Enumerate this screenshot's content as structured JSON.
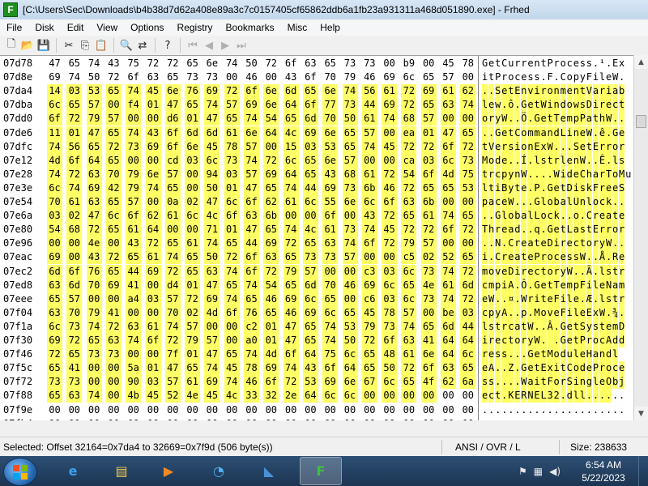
{
  "window": {
    "title": "[C:\\Users\\Sec\\Downloads\\b4b38d7d62a408e89a3c7c0157405cf65862ddb6a1fb23a931311a468d051890.exe] - Frhed",
    "icon": "frhed-icon",
    "icon_letter": "F"
  },
  "menu": [
    "File",
    "Disk",
    "Edit",
    "View",
    "Options",
    "Registry",
    "Bookmarks",
    "Misc",
    "Help"
  ],
  "toolbar": {
    "buttons": [
      {
        "name": "new-icon",
        "glyph": "🗋"
      },
      {
        "name": "open-icon",
        "glyph": "📂"
      },
      {
        "name": "save-icon",
        "glyph": "💾"
      },
      {
        "name": "cut-icon",
        "glyph": "✂"
      },
      {
        "name": "copy-icon",
        "glyph": "⎘"
      },
      {
        "name": "paste-icon",
        "glyph": "📋"
      },
      {
        "name": "find-icon",
        "glyph": "🔍"
      },
      {
        "name": "replace-icon",
        "glyph": "⇄"
      },
      {
        "name": "help-icon",
        "glyph": "?"
      },
      {
        "name": "first-icon",
        "glyph": "⏮"
      },
      {
        "name": "prev-icon",
        "glyph": "◀"
      },
      {
        "name": "next-icon",
        "glyph": "▶"
      },
      {
        "name": "last-icon",
        "glyph": "⏭"
      }
    ]
  },
  "hex": {
    "selection_color": "#ffff66",
    "rows": [
      {
        "offset": "07d78",
        "bytes": [
          "47",
          "65",
          "74",
          "43",
          "75",
          "72",
          "72",
          "65",
          "6e",
          "74",
          "50",
          "72",
          "6f",
          "63",
          "65",
          "73",
          "73",
          "00",
          "b9",
          "00",
          "45",
          "78"
        ],
        "sel_from": -1,
        "sel_to": -1,
        "ascii": "GetCurrentProcess.¹.Ex"
      },
      {
        "offset": "07d8e",
        "bytes": [
          "69",
          "74",
          "50",
          "72",
          "6f",
          "63",
          "65",
          "73",
          "73",
          "00",
          "46",
          "00",
          "43",
          "6f",
          "70",
          "79",
          "46",
          "69",
          "6c",
          "65",
          "57",
          "00"
        ],
        "sel_from": -1,
        "sel_to": -1,
        "ascii": "itProcess.F.CopyFileW."
      },
      {
        "offset": "07da4",
        "bytes": [
          "14",
          "03",
          "53",
          "65",
          "74",
          "45",
          "6e",
          "76",
          "69",
          "72",
          "6f",
          "6e",
          "6d",
          "65",
          "6e",
          "74",
          "56",
          "61",
          "72",
          "69",
          "61",
          "62"
        ],
        "sel_from": 0,
        "sel_to": 21,
        "ascii": "..SetEnvironmentVariab"
      },
      {
        "offset": "07dba",
        "bytes": [
          "6c",
          "65",
          "57",
          "00",
          "f4",
          "01",
          "47",
          "65",
          "74",
          "57",
          "69",
          "6e",
          "64",
          "6f",
          "77",
          "73",
          "44",
          "69",
          "72",
          "65",
          "63",
          "74"
        ],
        "sel_from": 0,
        "sel_to": 21,
        "ascii": "lew.ô.GetWindowsDirect"
      },
      {
        "offset": "07dd0",
        "bytes": [
          "6f",
          "72",
          "79",
          "57",
          "00",
          "00",
          "d6",
          "01",
          "47",
          "65",
          "74",
          "54",
          "65",
          "6d",
          "70",
          "50",
          "61",
          "74",
          "68",
          "57",
          "00",
          "00"
        ],
        "sel_from": 0,
        "sel_to": 21,
        "ascii": "oryW..Ö.GetTempPathW.."
      },
      {
        "offset": "07de6",
        "bytes": [
          "11",
          "01",
          "47",
          "65",
          "74",
          "43",
          "6f",
          "6d",
          "6d",
          "61",
          "6e",
          "64",
          "4c",
          "69",
          "6e",
          "65",
          "57",
          "00",
          "ea",
          "01",
          "47",
          "65"
        ],
        "sel_from": 0,
        "sel_to": 21,
        "ascii": "..GetCommandLineW.ê.Ge"
      },
      {
        "offset": "07dfc",
        "bytes": [
          "74",
          "56",
          "65",
          "72",
          "73",
          "69",
          "6f",
          "6e",
          "45",
          "78",
          "57",
          "00",
          "15",
          "03",
          "53",
          "65",
          "74",
          "45",
          "72",
          "72",
          "6f",
          "72"
        ],
        "sel_from": 0,
        "sel_to": 21,
        "ascii": "tVersionExW...SetError"
      },
      {
        "offset": "07e12",
        "bytes": [
          "4d",
          "6f",
          "64",
          "65",
          "00",
          "00",
          "cd",
          "03",
          "6c",
          "73",
          "74",
          "72",
          "6c",
          "65",
          "6e",
          "57",
          "00",
          "00",
          "ca",
          "03",
          "6c",
          "73"
        ],
        "sel_from": 0,
        "sel_to": 21,
        "ascii": "Mode..Í.lstrlenW..Ê.ls"
      },
      {
        "offset": "07e28",
        "bytes": [
          "74",
          "72",
          "63",
          "70",
          "79",
          "6e",
          "57",
          "00",
          "94",
          "03",
          "57",
          "69",
          "64",
          "65",
          "43",
          "68",
          "61",
          "72",
          "54",
          "6f",
          "4d",
          "75"
        ],
        "sel_from": 0,
        "sel_to": 21,
        "ascii": "trcpynW....WideCharToMu"
      },
      {
        "offset": "07e3e",
        "bytes": [
          "6c",
          "74",
          "69",
          "42",
          "79",
          "74",
          "65",
          "00",
          "50",
          "01",
          "47",
          "65",
          "74",
          "44",
          "69",
          "73",
          "6b",
          "46",
          "72",
          "65",
          "65",
          "53"
        ],
        "sel_from": 0,
        "sel_to": 21,
        "ascii": "ltiByte.P.GetDiskFreeS"
      },
      {
        "offset": "07e54",
        "bytes": [
          "70",
          "61",
          "63",
          "65",
          "57",
          "00",
          "0a",
          "02",
          "47",
          "6c",
          "6f",
          "62",
          "61",
          "6c",
          "55",
          "6e",
          "6c",
          "6f",
          "63",
          "6b",
          "00",
          "00"
        ],
        "sel_from": 0,
        "sel_to": 21,
        "ascii": "paceW...GlobalUnlock.."
      },
      {
        "offset": "07e6a",
        "bytes": [
          "03",
          "02",
          "47",
          "6c",
          "6f",
          "62",
          "61",
          "6c",
          "4c",
          "6f",
          "63",
          "6b",
          "00",
          "00",
          "6f",
          "00",
          "43",
          "72",
          "65",
          "61",
          "74",
          "65"
        ],
        "sel_from": 0,
        "sel_to": 21,
        "ascii": "..GlobalLock..o.Create"
      },
      {
        "offset": "07e80",
        "bytes": [
          "54",
          "68",
          "72",
          "65",
          "61",
          "64",
          "00",
          "00",
          "71",
          "01",
          "47",
          "65",
          "74",
          "4c",
          "61",
          "73",
          "74",
          "45",
          "72",
          "72",
          "6f",
          "72"
        ],
        "sel_from": 0,
        "sel_to": 21,
        "ascii": "Thread..q.GetLastError"
      },
      {
        "offset": "07e96",
        "bytes": [
          "00",
          "00",
          "4e",
          "00",
          "43",
          "72",
          "65",
          "61",
          "74",
          "65",
          "44",
          "69",
          "72",
          "65",
          "63",
          "74",
          "6f",
          "72",
          "79",
          "57",
          "00",
          "00"
        ],
        "sel_from": 0,
        "sel_to": 21,
        "ascii": "..N.CreateDirectoryW.."
      },
      {
        "offset": "07eac",
        "bytes": [
          "69",
          "00",
          "43",
          "72",
          "65",
          "61",
          "74",
          "65",
          "50",
          "72",
          "6f",
          "63",
          "65",
          "73",
          "73",
          "57",
          "00",
          "00",
          "c5",
          "02",
          "52",
          "65"
        ],
        "sel_from": 0,
        "sel_to": 21,
        "ascii": "i.CreateProcessW..Å.Re"
      },
      {
        "offset": "07ec2",
        "bytes": [
          "6d",
          "6f",
          "76",
          "65",
          "44",
          "69",
          "72",
          "65",
          "63",
          "74",
          "6f",
          "72",
          "79",
          "57",
          "00",
          "00",
          "c3",
          "03",
          "6c",
          "73",
          "74",
          "72"
        ],
        "sel_from": 0,
        "sel_to": 21,
        "ascii": "moveDirectoryW..Ã.lstr"
      },
      {
        "offset": "07ed8",
        "bytes": [
          "63",
          "6d",
          "70",
          "69",
          "41",
          "00",
          "d4",
          "01",
          "47",
          "65",
          "74",
          "54",
          "65",
          "6d",
          "70",
          "46",
          "69",
          "6c",
          "65",
          "4e",
          "61",
          "6d"
        ],
        "sel_from": 0,
        "sel_to": 21,
        "ascii": "cmpiA.Ô.GetTempFileNam"
      },
      {
        "offset": "07eee",
        "bytes": [
          "65",
          "57",
          "00",
          "00",
          "a4",
          "03",
          "57",
          "72",
          "69",
          "74",
          "65",
          "46",
          "69",
          "6c",
          "65",
          "00",
          "c6",
          "03",
          "6c",
          "73",
          "74",
          "72"
        ],
        "sel_from": 0,
        "sel_to": 21,
        "ascii": "eW..¤.WriteFile.Æ.lstr"
      },
      {
        "offset": "07f04",
        "bytes": [
          "63",
          "70",
          "79",
          "41",
          "00",
          "00",
          "70",
          "02",
          "4d",
          "6f",
          "76",
          "65",
          "46",
          "69",
          "6c",
          "65",
          "45",
          "78",
          "57",
          "00",
          "be",
          "03"
        ],
        "sel_from": 0,
        "sel_to": 21,
        "ascii": "cpyA..p.MoveFileExW.¾."
      },
      {
        "offset": "07f1a",
        "bytes": [
          "6c",
          "73",
          "74",
          "72",
          "63",
          "61",
          "74",
          "57",
          "00",
          "00",
          "c2",
          "01",
          "47",
          "65",
          "74",
          "53",
          "79",
          "73",
          "74",
          "65",
          "6d",
          "44"
        ],
        "sel_from": 0,
        "sel_to": 21,
        "ascii": "lstrcatW..Â.GetSystemD"
      },
      {
        "offset": "07f30",
        "bytes": [
          "69",
          "72",
          "65",
          "63",
          "74",
          "6f",
          "72",
          "79",
          "57",
          "00",
          "a0",
          "01",
          "47",
          "65",
          "74",
          "50",
          "72",
          "6f",
          "63",
          "41",
          "64",
          "64"
        ],
        "sel_from": 0,
        "sel_to": 21,
        "ascii": "irectoryW. .GetProcAdd"
      },
      {
        "offset": "07f46",
        "bytes": [
          "72",
          "65",
          "73",
          "73",
          "00",
          "00",
          "7f",
          "01",
          "47",
          "65",
          "74",
          "4d",
          "6f",
          "64",
          "75",
          "6c",
          "65",
          "48",
          "61",
          "6e",
          "64",
          "6c"
        ],
        "sel_from": 0,
        "sel_to": 21,
        "ascii": "ress...GetModuleHandl"
      },
      {
        "offset": "07f5c",
        "bytes": [
          "65",
          "41",
          "00",
          "00",
          "5a",
          "01",
          "47",
          "65",
          "74",
          "45",
          "78",
          "69",
          "74",
          "43",
          "6f",
          "64",
          "65",
          "50",
          "72",
          "6f",
          "63",
          "65"
        ],
        "sel_from": 0,
        "sel_to": 21,
        "ascii": "eA..Z.GetExitCodeProce"
      },
      {
        "offset": "07f72",
        "bytes": [
          "73",
          "73",
          "00",
          "00",
          "90",
          "03",
          "57",
          "61",
          "69",
          "74",
          "46",
          "6f",
          "72",
          "53",
          "69",
          "6e",
          "67",
          "6c",
          "65",
          "4f",
          "62",
          "6a"
        ],
        "sel_from": 0,
        "sel_to": 21,
        "ascii": "ss....WaitForSingleObj"
      },
      {
        "offset": "07f88",
        "bytes": [
          "65",
          "63",
          "74",
          "00",
          "4b",
          "45",
          "52",
          "4e",
          "45",
          "4c",
          "33",
          "32",
          "2e",
          "64",
          "6c",
          "6c",
          "00",
          "00",
          "00",
          "00",
          "00",
          "00"
        ],
        "sel_from": 0,
        "sel_to": 19,
        "ascii": "ect.KERNEL32.dll......"
      },
      {
        "offset": "07f9e",
        "bytes": [
          "00",
          "00",
          "00",
          "00",
          "00",
          "00",
          "00",
          "00",
          "00",
          "00",
          "00",
          "00",
          "00",
          "00",
          "00",
          "00",
          "00",
          "00",
          "00",
          "00",
          "00",
          "00"
        ],
        "sel_from": -1,
        "sel_to": -1,
        "ascii": "......................"
      },
      {
        "offset": "07fb4",
        "bytes": [
          "00",
          "00",
          "00",
          "00",
          "00",
          "00",
          "00",
          "00",
          "00",
          "00",
          "00",
          "00",
          "00",
          "00",
          "00",
          "00",
          "00",
          "00",
          "00",
          "00",
          "00",
          "00"
        ],
        "sel_from": -1,
        "sel_to": -1,
        "ascii": "......................"
      },
      {
        "offset": "07fca",
        "bytes": [
          "00",
          "00",
          "00",
          "00",
          "00",
          "00",
          "00",
          "00",
          "00",
          "00",
          "00",
          "00",
          "00",
          "00",
          "00",
          "00",
          "00",
          "00",
          "00",
          "00",
          "00",
          "00"
        ],
        "sel_from": -1,
        "sel_to": -1,
        "ascii": "......................"
      },
      {
        "offset": "07fe0",
        "bytes": [
          "00",
          "00",
          "00",
          "00",
          "00",
          "00",
          "00",
          "00",
          "00",
          "00",
          "00",
          "00",
          "00",
          "00",
          "00",
          "00",
          "00",
          "00",
          "00",
          "00",
          "00",
          "00"
        ],
        "sel_from": -1,
        "sel_to": -1,
        "ascii": "......................"
      },
      {
        "offset": "07ff6",
        "bytes": [
          "00",
          "00",
          "00",
          "00",
          "00",
          "00",
          "00",
          "00",
          "e0",
          "a2",
          "42",
          "00",
          "89",
          "13",
          "40",
          "00",
          "ef",
          "68",
          "40",
          "00"
        ],
        "sel_from": -1,
        "sel_to": -1,
        "ascii": "........à¢B..@.ïh@."
      }
    ]
  },
  "status": {
    "selection": "Selected: Offset 32164=0x7da4 to 32669=0x7f9d (506 byte(s))",
    "mode": "ANSI / OVR / L",
    "size": "Size: 238633"
  },
  "taskbar": {
    "apps": [
      {
        "name": "ie-icon",
        "glyph": "e",
        "color": "#3aa0f0",
        "active": false
      },
      {
        "name": "explorer-icon",
        "glyph": "▤",
        "color": "#f2c84b",
        "active": false
      },
      {
        "name": "media-player-icon",
        "glyph": "▶",
        "color": "#f08a24",
        "active": false
      },
      {
        "name": "network-tool-icon",
        "glyph": "◔",
        "color": "#4fb3f5",
        "active": false
      },
      {
        "name": "wireshark-icon",
        "glyph": "◣",
        "color": "#4a90d9",
        "active": false
      },
      {
        "name": "frhed-taskbar-icon",
        "glyph": "F",
        "color": "#3fbf3f",
        "active": true
      }
    ],
    "time": "6:54 AM",
    "date": "5/22/2023"
  }
}
